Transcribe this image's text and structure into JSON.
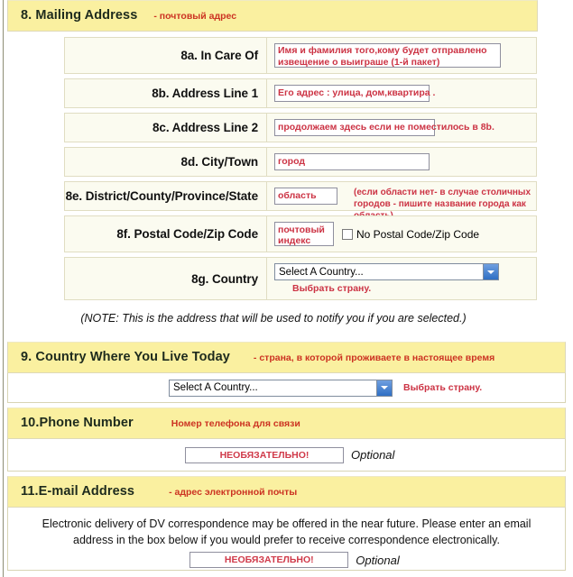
{
  "sections": {
    "s8": {
      "number": "8.",
      "title": "8. Mailing Address",
      "ru": "- почтовый адрес",
      "rows": [
        {
          "label": "8a. In Care Of",
          "value": "Имя и фамилия того,кому будет отправлено извещение о выиграше (1-й пакет)"
        },
        {
          "label": "8b. Address Line 1",
          "value": "Его адрес : улица, дом,квартира ."
        },
        {
          "label": "8c. Address Line 2",
          "value": "продолжаем здесь если не поместилось в 8b."
        },
        {
          "label": "8d. City/Town",
          "value": "город"
        },
        {
          "label": "8e. District/County/Province/State",
          "value": "область",
          "note": "(если области нет- в случае столичных городов - пишите название города как область)"
        },
        {
          "label": "8f. Postal Code/Zip Code",
          "value": "почтовый индекс",
          "checkbox_label": "No Postal Code/Zip Code",
          "checkbox_checked": false
        },
        {
          "label": "8g. Country",
          "select_value": "Select A Country...",
          "sub": "Выбрать страну."
        }
      ],
      "note": "(NOTE: This is the address that will be used to notify you if you are selected.)"
    },
    "s9": {
      "title": "9.  Country Where You Live Today",
      "ru": "- страна, в которой проживаете в настоящее время",
      "select_value": "Select A Country...",
      "after": "Выбрать страну."
    },
    "s10": {
      "title": "10.Phone Number",
      "ru": "Номер телефона для связи",
      "input_value": "НЕОБЯЗАТЕЛЬНО!",
      "optional": "Optional"
    },
    "s11": {
      "title": "11.E-mail Address",
      "ru": "- адрес электронной почты",
      "copy_line1": "Electronic delivery of DV correspondence may be offered in the near future. Please enter an email",
      "copy_line2": "address in the box below if you would prefer to receive correspondence electronically.",
      "input_value": "НЕОБЯЗАТЕЛЬНО!",
      "optional": "Optional"
    }
  }
}
